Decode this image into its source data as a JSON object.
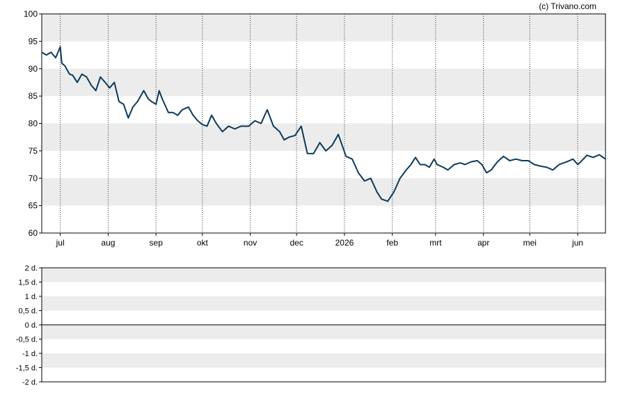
{
  "copyright": "(c) Trivano.com",
  "chart_data": [
    {
      "type": "line",
      "title": "",
      "xlabel": "",
      "ylabel": "",
      "ylim": [
        60,
        100
      ],
      "yticks": [
        60,
        65,
        70,
        75,
        80,
        85,
        90,
        95,
        100
      ],
      "ytick_labels": [
        "60",
        "65",
        "70",
        "75",
        "80",
        "85",
        "90",
        "95",
        "100"
      ],
      "x_start": "2025-06-19",
      "x_end": "2026-06-19",
      "x_months": [
        {
          "label": "jul",
          "date": "2025-07-01"
        },
        {
          "label": "aug",
          "date": "2025-08-01"
        },
        {
          "label": "sep",
          "date": "2025-09-01"
        },
        {
          "label": "okt",
          "date": "2025-10-01"
        },
        {
          "label": "nov",
          "date": "2025-11-01"
        },
        {
          "label": "dec",
          "date": "2025-12-01"
        },
        {
          "label": "2026",
          "date": "2026-01-01"
        },
        {
          "label": "feb",
          "date": "2026-02-01"
        },
        {
          "label": "mrt",
          "date": "2026-03-01"
        },
        {
          "label": "apr",
          "date": "2026-04-01"
        },
        {
          "label": "mei",
          "date": "2026-05-01"
        },
        {
          "label": "jun",
          "date": "2026-06-01"
        }
      ],
      "grid": "horizontal bands, dotted vertical month lines",
      "line_color": "#0b3a5a",
      "series": [
        {
          "x": [
            "2025-06-19",
            "2025-06-22",
            "2025-06-25",
            "2025-06-28",
            "2025-07-01",
            "2025-07-02",
            "2025-07-04",
            "2025-07-07",
            "2025-07-09",
            "2025-07-12",
            "2025-07-15",
            "2025-07-18",
            "2025-07-21",
            "2025-07-24",
            "2025-07-27",
            "2025-07-30",
            "2025-08-02",
            "2025-08-05",
            "2025-08-08",
            "2025-08-11",
            "2025-08-14",
            "2025-08-17",
            "2025-08-20",
            "2025-08-24",
            "2025-08-27",
            "2025-08-29",
            "2025-09-01",
            "2025-09-03",
            "2025-09-05",
            "2025-09-09",
            "2025-09-12",
            "2025-09-15",
            "2025-09-18",
            "2025-09-22",
            "2025-09-25",
            "2025-09-28",
            "2025-10-01",
            "2025-10-04",
            "2025-10-07",
            "2025-10-10",
            "2025-10-14",
            "2025-10-18",
            "2025-10-22",
            "2025-10-26",
            "2025-10-31",
            "2025-11-04",
            "2025-11-08",
            "2025-11-12",
            "2025-11-16",
            "2025-11-20",
            "2025-11-23",
            "2025-11-26",
            "2025-11-30",
            "2025-12-04",
            "2025-12-08",
            "2025-12-12",
            "2025-12-16",
            "2025-12-20",
            "2025-12-24",
            "2025-12-28",
            "2026-01-02",
            "2026-01-06",
            "2026-01-10",
            "2026-01-14",
            "2026-01-18",
            "2026-01-22",
            "2026-01-25",
            "2026-01-29",
            "2026-02-02",
            "2026-02-06",
            "2026-02-10",
            "2026-02-13",
            "2026-02-16",
            "2026-02-19",
            "2026-02-22",
            "2026-02-25",
            "2026-02-28",
            "2026-03-02",
            "2026-03-06",
            "2026-03-09",
            "2026-03-13",
            "2026-03-17",
            "2026-03-20",
            "2026-03-24",
            "2026-03-28",
            "2026-03-31",
            "2026-04-03",
            "2026-04-06",
            "2026-04-10",
            "2026-04-14",
            "2026-04-18",
            "2026-04-22",
            "2026-04-26",
            "2026-04-30",
            "2026-05-04",
            "2026-05-08",
            "2026-05-12",
            "2026-05-16",
            "2026-05-20",
            "2026-05-25",
            "2026-05-29",
            "2026-06-01",
            "2026-06-03",
            "2026-06-07",
            "2026-06-11",
            "2026-06-15",
            "2026-06-19"
          ],
          "values": [
            93.0,
            92.5,
            93.0,
            92.0,
            94.0,
            91.0,
            90.5,
            89.0,
            88.8,
            87.5,
            89.0,
            88.5,
            87.0,
            86.0,
            88.5,
            87.5,
            86.5,
            87.5,
            84.0,
            83.5,
            81.0,
            83.0,
            84.0,
            86.0,
            84.5,
            84.0,
            83.5,
            86.0,
            84.5,
            82.0,
            82.0,
            81.5,
            82.5,
            83.0,
            81.5,
            80.5,
            79.8,
            79.5,
            81.5,
            80.0,
            78.5,
            79.5,
            79.0,
            79.5,
            79.5,
            80.5,
            80.0,
            82.5,
            79.5,
            78.5,
            77.0,
            77.5,
            77.8,
            79.5,
            74.5,
            74.5,
            76.5,
            75.0,
            76.0,
            78.0,
            74.0,
            73.5,
            71.0,
            69.5,
            70.0,
            67.5,
            66.2,
            65.8,
            67.5,
            70.0,
            71.5,
            72.5,
            73.8,
            72.5,
            72.5,
            72.0,
            73.5,
            72.5,
            72.0,
            71.5,
            72.5,
            72.8,
            72.5,
            73.0,
            73.2,
            72.5,
            71.0,
            71.5,
            73.0,
            74.0,
            73.2,
            73.5,
            73.2,
            73.2,
            72.5,
            72.2,
            72.0,
            71.5,
            72.5,
            73.0,
            73.5,
            72.5,
            73.0,
            74.2,
            73.8,
            74.3,
            73.5
          ]
        }
      ]
    },
    {
      "type": "line",
      "title": "",
      "xlabel": "",
      "ylabel": "",
      "ylim": [
        -2,
        2
      ],
      "ytick_labels": [
        "2 d.",
        "1,5 d.",
        "1 d.",
        "0,5 d.",
        "0 d.",
        "-0,5 d.",
        "-1 d.",
        "-1,5 d.",
        "-2 d."
      ],
      "series": []
    }
  ]
}
